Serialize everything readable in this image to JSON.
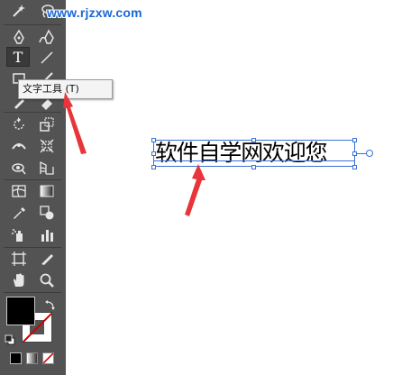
{
  "watermark": "www.rjzxw.com",
  "tooltip": {
    "label": "文字工具 (T)"
  },
  "canvas": {
    "text": "软件自学网欢迎您"
  },
  "tools": [
    {
      "name": "magic-wand-icon"
    },
    {
      "name": "lasso-icon"
    },
    {
      "name": "pen-icon"
    },
    {
      "name": "curvature-icon"
    },
    {
      "name": "type-tool-icon",
      "active": true
    },
    {
      "name": "line-segment-icon"
    },
    {
      "name": "rectangle-icon"
    },
    {
      "name": "paintbrush-icon"
    },
    {
      "name": "pencil-icon"
    },
    {
      "name": "eraser-icon"
    },
    {
      "name": "rotate-icon"
    },
    {
      "name": "scale-icon"
    },
    {
      "name": "width-tool-icon"
    },
    {
      "name": "free-transform-icon"
    },
    {
      "name": "shape-builder-icon"
    },
    {
      "name": "perspective-grid-icon"
    },
    {
      "name": "mesh-icon"
    },
    {
      "name": "gradient-icon"
    },
    {
      "name": "eyedropper-icon"
    },
    {
      "name": "blend-icon"
    },
    {
      "name": "symbol-sprayer-icon"
    },
    {
      "name": "column-graph-icon"
    },
    {
      "name": "artboard-icon"
    },
    {
      "name": "slice-icon"
    },
    {
      "name": "hand-icon"
    },
    {
      "name": "zoom-icon"
    }
  ],
  "colors": {
    "panel": "#535353",
    "accent": "#3a73d6",
    "arrow": "#e8353b",
    "watermark": "#1a68d6"
  }
}
